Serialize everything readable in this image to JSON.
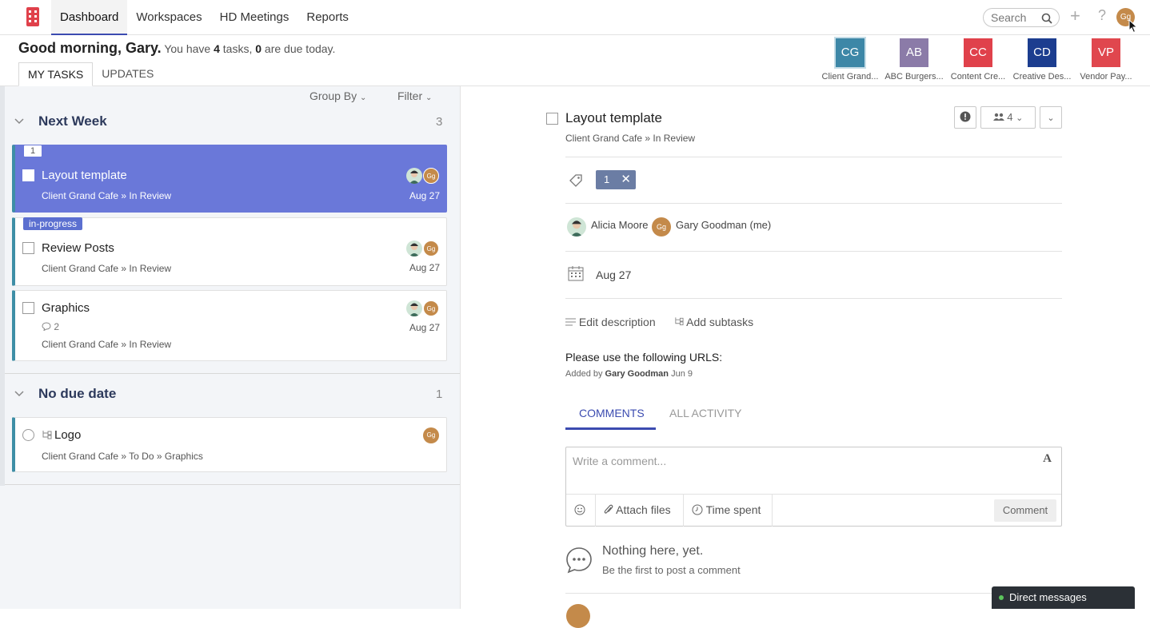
{
  "nav": {
    "items": [
      {
        "label": "Dashboard"
      },
      {
        "label": "Workspaces"
      },
      {
        "label": "HD Meetings"
      },
      {
        "label": "Reports"
      }
    ],
    "search_placeholder": "Search",
    "plus": "+",
    "help": "?",
    "user_initials": "Gg"
  },
  "greeting": {
    "hello": "Good morning, Gary.",
    "text1": " You have ",
    "tasks": "4",
    "text2": " tasks, ",
    "due": "0",
    "text3": " are due today."
  },
  "tabs": [
    {
      "label": "MY TASKS"
    },
    {
      "label": "UPDATES"
    }
  ],
  "workspaces": [
    {
      "initials": "CG",
      "label": "Client Grand...",
      "color": "#3d87a7"
    },
    {
      "initials": "AB",
      "label": "ABC Burgers...",
      "color": "#8b7ba8"
    },
    {
      "initials": "CC",
      "label": "Content Cre...",
      "color": "#e0414b"
    },
    {
      "initials": "CD",
      "label": "Creative Des...",
      "color": "#1c3d8f"
    },
    {
      "initials": "VP",
      "label": "Vendor Pay...",
      "color": "#e0474e"
    }
  ],
  "list": {
    "group_by": "Group By",
    "filter": "Filter",
    "sections": [
      {
        "title": "Next Week",
        "count": "3"
      },
      {
        "title": "No due date",
        "count": "1"
      }
    ],
    "tasks": [
      {
        "badge": "1",
        "title": "Layout template",
        "sub": "Client Grand Cafe » In Review",
        "date": "Aug 27"
      },
      {
        "badge": "in-progress",
        "title": "Review Posts",
        "sub": "Client Grand Cafe » In Review",
        "date": "Aug 27"
      },
      {
        "title": "Graphics",
        "comments": "2",
        "sub": "Client Grand Cafe » In Review",
        "date": "Aug 27"
      },
      {
        "title": "Logo",
        "sub": "Client Grand Cafe » To Do » Graphics"
      }
    ]
  },
  "detail": {
    "title": "Layout template",
    "breadcrumb": "Client Grand Cafe » In Review",
    "followers_count": "4",
    "tag": "1",
    "assignees": [
      "Alicia Moore",
      "Gary Goodman (me)"
    ],
    "due": "Aug 27",
    "edit_description": "Edit description",
    "add_subtasks": "Add subtasks",
    "description": "Please use the following URLS:",
    "added_prefix": "Added by ",
    "added_by": "Gary Goodman",
    "added_date": " Jun 9",
    "comment_tabs": [
      "COMMENTS",
      "ALL ACTIVITY"
    ],
    "comment_placeholder": "Write a comment...",
    "format_glyph": "A",
    "attach_files": "Attach files",
    "time_spent": "Time spent",
    "comment_button": "Comment",
    "empty_title": "Nothing here, yet.",
    "empty_sub": "Be the first to post a comment"
  },
  "direct_messages": "Direct messages"
}
